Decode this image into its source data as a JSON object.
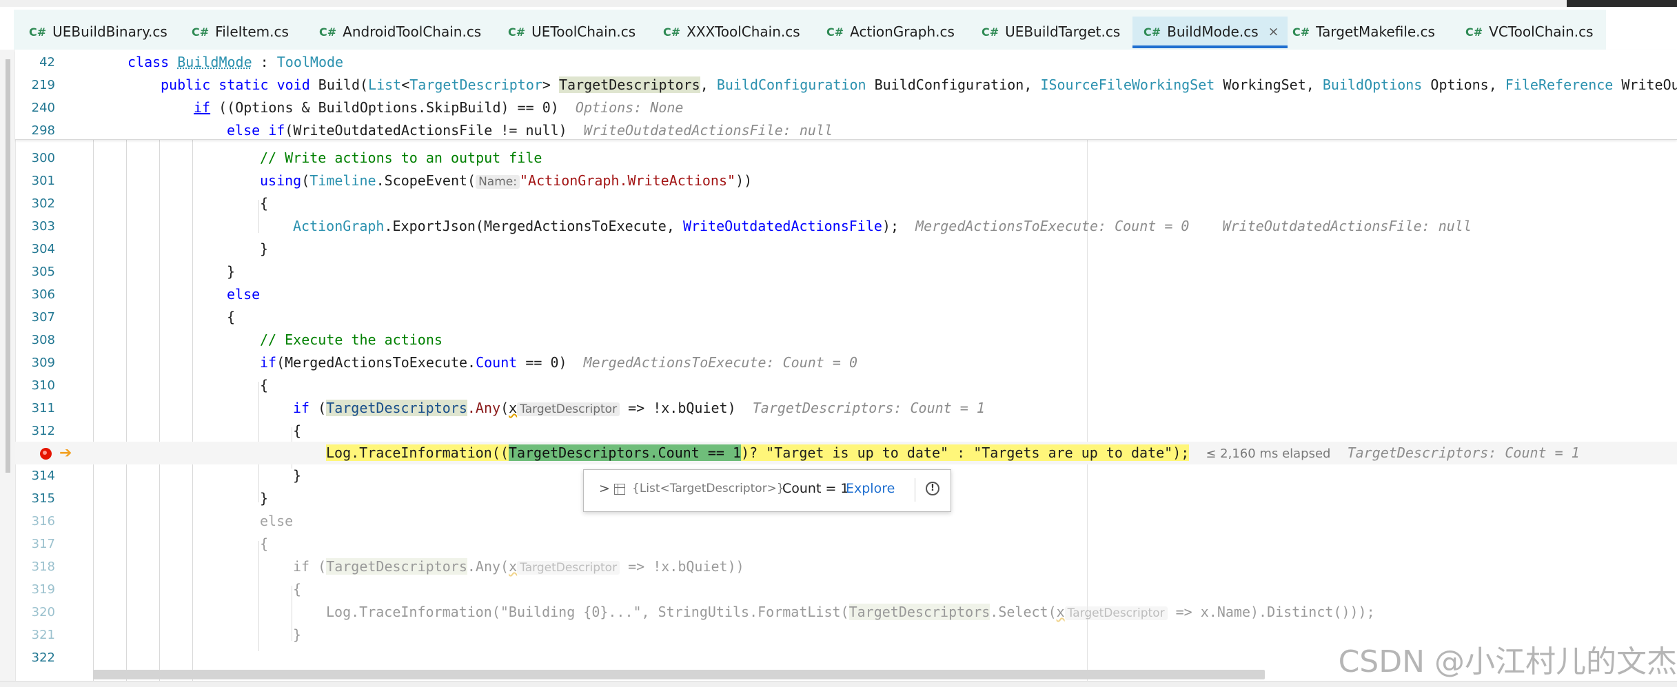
{
  "tabs": [
    {
      "prefix": "C#",
      "label": "UEBuildBinary.cs"
    },
    {
      "prefix": "C#",
      "label": "FileItem.cs"
    },
    {
      "prefix": "C#",
      "label": "AndroidToolChain.cs"
    },
    {
      "prefix": "C#",
      "label": "UEToolChain.cs"
    },
    {
      "prefix": "C#",
      "label": "XXXToolChain.cs"
    },
    {
      "prefix": "C#",
      "label": "ActionGraph.cs"
    },
    {
      "prefix": "C#",
      "label": "UEBuildTarget.cs"
    },
    {
      "prefix": "C#",
      "label": "BuildMode.cs",
      "active": true,
      "close": "×"
    },
    {
      "prefix": "C#",
      "label": "TargetMakefile.cs"
    },
    {
      "prefix": "C#",
      "label": "VCToolChain.cs"
    }
  ],
  "sticky": {
    "n42": "42",
    "n219": "219",
    "n240": "240",
    "n298": "298",
    "l42": {
      "kw": "class",
      "name": "BuildMode",
      "colon": " : ",
      "base": "ToolMode"
    },
    "l219": {
      "kw": "public static void",
      "method": " Build(",
      "t1": "List",
      "lt": "<",
      "t2": "TargetDescriptor",
      "gt": "> ",
      "p1": "TargetDescriptors",
      "comma1": ", ",
      "t3": "BuildConfiguration",
      "p2": " BuildConfiguration, ",
      "t4": "ISourceFileWorkingSet",
      "p3": " WorkingSet, ",
      "t5": "BuildOptions",
      "p4": " Options, ",
      "t6": "FileReference",
      "p5": " WriteOutdatedActionsFile"
    },
    "l240": {
      "kw": "if",
      "text": " ((Options & BuildOptions.SkipBuild) == 0)",
      "hint": "Options: None"
    },
    "l298": {
      "kw": "else if",
      "text": "(WriteOutdatedActionsFile != null)",
      "hint": "WriteOutdatedActionsFile: null"
    }
  },
  "code": {
    "n300": "300",
    "n301": "301",
    "n302": "302",
    "n303": "303",
    "n304": "304",
    "n305": "305",
    "n306": "306",
    "n307": "307",
    "n308": "308",
    "n309": "309",
    "n310": "310",
    "n311": "311",
    "n312": "312",
    "n314": "314",
    "n315": "315",
    "n316": "316",
    "n317": "317",
    "n318": "318",
    "n319": "319",
    "n320": "320",
    "n321": "321",
    "n322": "322",
    "l300": "// Write actions to an output file",
    "l301": {
      "kw": "using",
      "p1": "(",
      "t": "Timeline",
      "p2": ".ScopeEvent(",
      "param": "Name:",
      "str": "\"ActionGraph.WriteActions\"",
      "end": "))"
    },
    "brace_open": "{",
    "brace_close": "}",
    "l303": {
      "t": "ActionGraph",
      "p1": ".ExportJson(MergedActionsToExecute, ",
      "p2": "WriteOutdatedActionsFile",
      "p3": ");",
      "hint1": "MergedActionsToExecute: Count = 0",
      "hint2": "WriteOutdatedActionsFile: null"
    },
    "l306": "else",
    "l308": "// Execute the actions",
    "l309": {
      "kw": "if",
      "text": "(MergedActionsToExecute.",
      "count": "Count",
      "end": " == 0)",
      "hint": "MergedActionsToExecute: Count = 0"
    },
    "l311": {
      "kw": "if",
      "p1": " (",
      "ref": "TargetDescriptors",
      "mth": ".Any",
      "p2": "(",
      "x": "x",
      "param": "TargetDescriptor",
      "end": " => !x.bQuiet)",
      "hint": "TargetDescriptors: Count = 1"
    },
    "l313": {
      "a": "Log.TraceInformation((",
      "sel": "TargetDescriptors.Count == 1",
      "b": ")? \"Target is up to date\" : \"Targets are up to date\");",
      "elapsed": "≤ 2,160 ms elapsed",
      "hint": "TargetDescriptors: Count = 1"
    },
    "l316": "else",
    "l318": {
      "kw": "if",
      "p1": " (",
      "ref": "TargetDescriptors",
      "p2": ".Any(",
      "x": "x",
      "param": "TargetDescriptor",
      "end": " => !x.bQuiet))"
    },
    "l320": {
      "a": "Log.TraceInformation(\"Building {0}...\", StringUtils.FormatList(",
      "ref": "TargetDescriptors",
      "b": ".Select(",
      "x": "x",
      "param": "TargetDescriptor",
      "end": " => x.Name).Distinct()));"
    }
  },
  "datatip": {
    "chevron": ">",
    "type": "{List<TargetDescriptor>}",
    "value": "Count = 1",
    "explore": "Explore",
    "info": "!"
  },
  "watermark": "CSDN @小江村儿的文杰",
  "colors": {
    "keyword": "#0000ff",
    "type": "#2b91af",
    "string": "#a31515",
    "comment": "#008000",
    "highlight_yellow": "#fff67a",
    "highlight_green": "#6fbd7a",
    "breakpoint": "#e51400"
  }
}
